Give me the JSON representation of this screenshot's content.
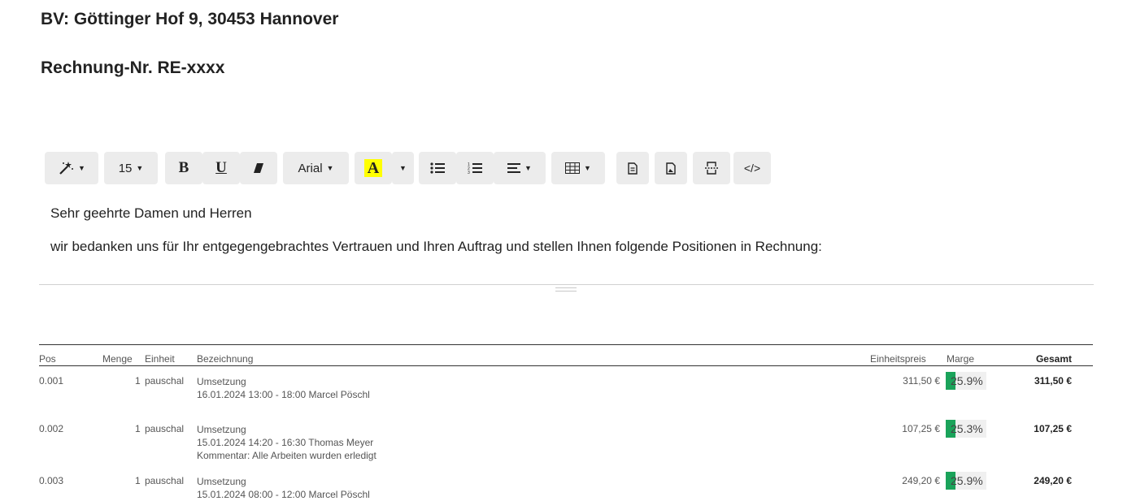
{
  "document": {
    "title": "BV: Göttinger Hof 9, 30453 Hannover",
    "subtitle": "Rechnung-Nr. RE-xxxx"
  },
  "toolbar": {
    "magic_icon": "magic-wand-icon",
    "font_size": "15",
    "bold_label": "B",
    "underline_label": "U",
    "eraser_icon": "eraser-icon",
    "font_family": "Arial",
    "color_label": "A",
    "highlight_color": "#ffff00",
    "ul_icon": "bullet-list-icon",
    "ol_icon": "numbered-list-icon",
    "align_icon": "align-icon",
    "table_icon": "table-icon",
    "doc_icon": "document-icon",
    "image_doc_icon": "image-document-icon",
    "page_break_icon": "page-break-icon",
    "code_label": "</>"
  },
  "editor": {
    "greeting": "Sehr geehrte Damen und Herren",
    "intro": "wir bedanken uns für Ihr entgegengebrachtes Vertrauen und Ihren Auftrag und stellen Ihnen folgende Positionen in Rechnung:"
  },
  "table": {
    "headers": {
      "pos": "Pos",
      "menge": "Menge",
      "einheit": "Einheit",
      "bezeichnung": "Bezeichnung",
      "einheitspreis": "Einheitspreis",
      "marge": "Marge",
      "gesamt": "Gesamt"
    },
    "rows": [
      {
        "pos": "0.001",
        "menge": "1",
        "einheit": "pauschal",
        "lines": [
          "Umsetzung",
          "16.01.2024 13:00 - 18:00 Marcel Pöschl"
        ],
        "einheitspreis": "311,50 €",
        "marge": "25.9%",
        "marge_fraction": 0.259,
        "gesamt": "311,50 €"
      },
      {
        "pos": "0.002",
        "menge": "1",
        "einheit": "pauschal",
        "lines": [
          "Umsetzung",
          "15.01.2024 14:20 - 16:30 Thomas Meyer",
          "Kommentar: Alle Arbeiten wurden erledigt"
        ],
        "einheitspreis": "107,25 €",
        "marge": "25.3%",
        "marge_fraction": 0.253,
        "gesamt": "107,25 €"
      },
      {
        "pos": "0.003",
        "menge": "1",
        "einheit": "pauschal",
        "lines": [
          "Umsetzung",
          "15.01.2024 08:00 - 12:00 Marcel Pöschl"
        ],
        "einheitspreis": "249,20 €",
        "marge": "25.9%",
        "marge_fraction": 0.259,
        "gesamt": "249,20 €"
      }
    ]
  },
  "colors": {
    "marge_fill": "#1aa35a",
    "toolbar_bg": "#ececec"
  }
}
